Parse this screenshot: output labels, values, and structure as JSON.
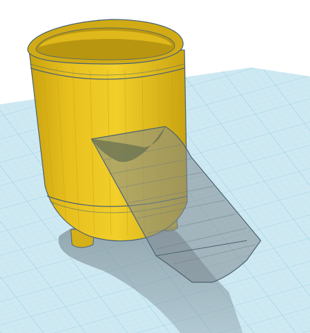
{
  "viewport": {
    "background": "#ffffff"
  },
  "workplane": {
    "color": "#cfe9f2",
    "major_grid_color": "#8ecfe4",
    "minor_grid_color": "#b3e0ee"
  },
  "shapes": [
    {
      "name": "cylinder-pot",
      "kind": "solid",
      "fill": "#e8c01e",
      "shade": "#c9a310",
      "edge_color": "#4a6272"
    },
    {
      "name": "hole-wedge",
      "kind": "hole",
      "fill": "#7f8b92",
      "opacity": 0.55,
      "edge_color": "#4a6272"
    }
  ]
}
